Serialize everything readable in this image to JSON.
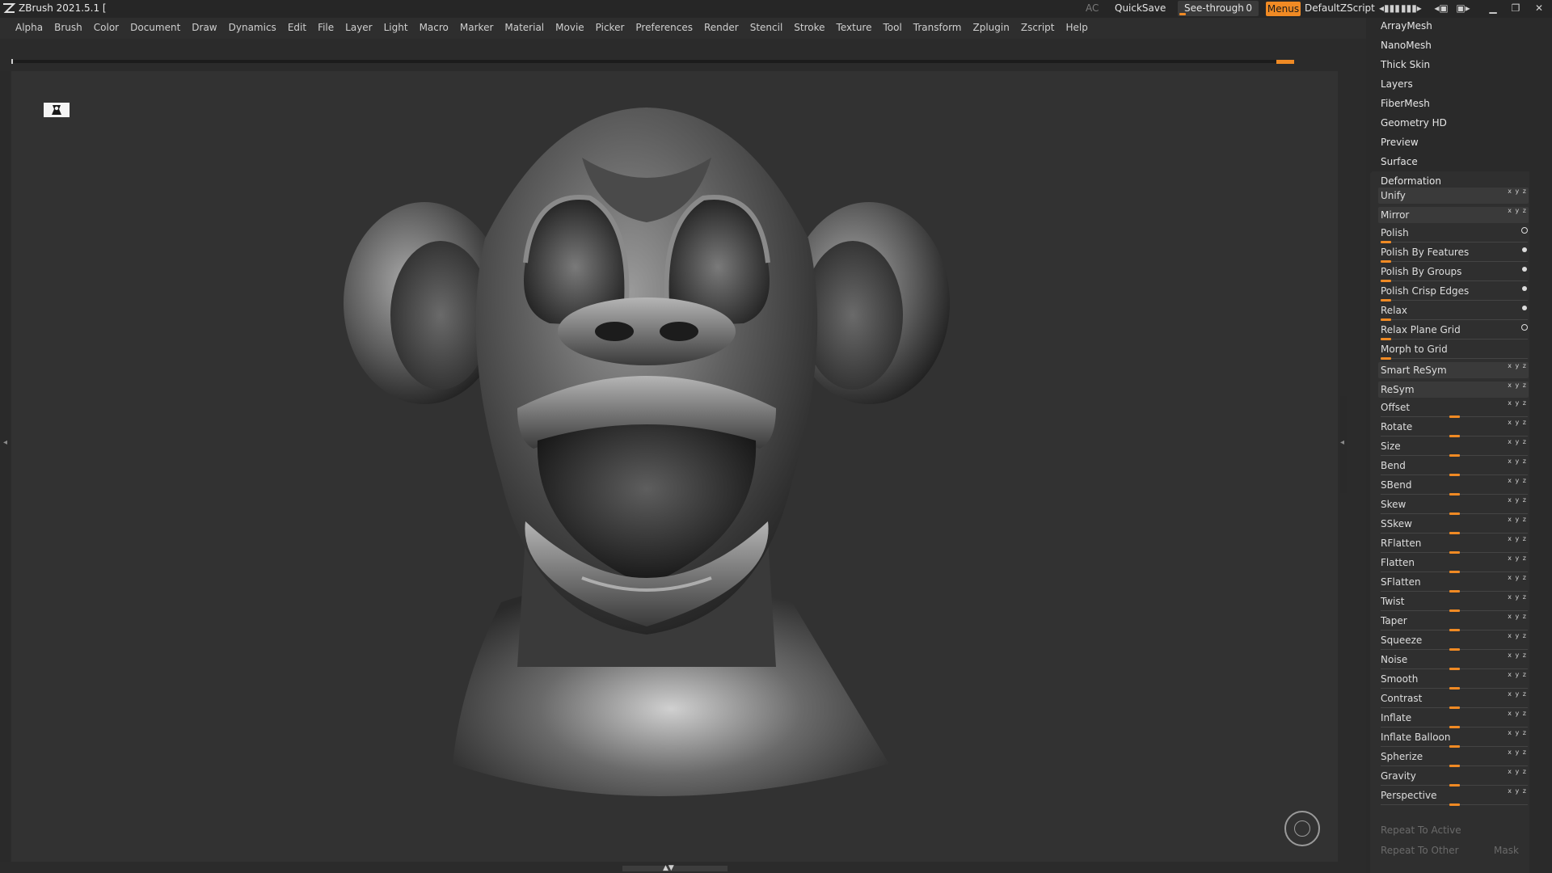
{
  "titlebar": {
    "app_title": "ZBrush 2021.5.1 [",
    "ac_label": "AC",
    "quicksave_label": "QuickSave",
    "seethrough_label": "See-through",
    "seethrough_value": "0",
    "menus_label": "Menus",
    "default_zscript_label": "DefaultZScript"
  },
  "menubar": {
    "items": [
      "Alpha",
      "Brush",
      "Color",
      "Document",
      "Draw",
      "Dynamics",
      "Edit",
      "File",
      "Layer",
      "Light",
      "Macro",
      "Marker",
      "Material",
      "Movie",
      "Picker",
      "Preferences",
      "Render",
      "Stencil",
      "Stroke",
      "Texture",
      "Tool",
      "Transform",
      "Zplugin",
      "Zscript",
      "Help"
    ]
  },
  "right_panel": {
    "sub_buttons": [
      "ArrayMesh",
      "NanoMesh",
      "Thick Skin",
      "Layers",
      "FiberMesh",
      "Geometry HD",
      "Preview",
      "Surface"
    ],
    "deformation": {
      "title": "Deformation",
      "rows": [
        {
          "label": "Unify",
          "kind": "button",
          "axes": "x y z"
        },
        {
          "label": "Mirror",
          "kind": "button",
          "axes": "x y z"
        },
        {
          "label": "Polish",
          "kind": "slider",
          "value": 0,
          "marker": "ring"
        },
        {
          "label": "Polish By Features",
          "kind": "slider",
          "value": 0,
          "marker": "dot"
        },
        {
          "label": "Polish By Groups",
          "kind": "slider",
          "value": 0,
          "marker": "dot"
        },
        {
          "label": "Polish Crisp Edges",
          "kind": "slider",
          "value": 0,
          "marker": "dot"
        },
        {
          "label": "Relax",
          "kind": "slider",
          "value": 0,
          "marker": "dot"
        },
        {
          "label": "Relax Plane Grid",
          "kind": "slider",
          "value": 0,
          "marker": "ring"
        },
        {
          "label": "Morph to Grid",
          "kind": "slider",
          "value": 0,
          "marker": ""
        },
        {
          "label": "Smart ReSym",
          "kind": "button",
          "axes": "x y z"
        },
        {
          "label": "ReSym",
          "kind": "button",
          "axes": "x y z"
        },
        {
          "label": "Offset",
          "kind": "slider",
          "value": 0.5,
          "axes": "x y z"
        },
        {
          "label": "Rotate",
          "kind": "slider",
          "value": 0.5,
          "axes": "x y z"
        },
        {
          "label": "Size",
          "kind": "slider",
          "value": 0.5,
          "axes": "x y z"
        },
        {
          "label": "Bend",
          "kind": "slider",
          "value": 0.5,
          "axes": "x y z"
        },
        {
          "label": "SBend",
          "kind": "slider",
          "value": 0.5,
          "axes": "x y z"
        },
        {
          "label": "Skew",
          "kind": "slider",
          "value": 0.5,
          "axes": "x y z"
        },
        {
          "label": "SSkew",
          "kind": "slider",
          "value": 0.5,
          "axes": "x y z"
        },
        {
          "label": "RFlatten",
          "kind": "slider",
          "value": 0.5,
          "axes": "x y z"
        },
        {
          "label": "Flatten",
          "kind": "slider",
          "value": 0.5,
          "axes": "x y z"
        },
        {
          "label": "SFlatten",
          "kind": "slider",
          "value": 0.5,
          "axes": "x y z"
        },
        {
          "label": "Twist",
          "kind": "slider",
          "value": 0.5,
          "axes": "x y z"
        },
        {
          "label": "Taper",
          "kind": "slider",
          "value": 0.5,
          "axes": "x y z"
        },
        {
          "label": "Squeeze",
          "kind": "slider",
          "value": 0.5,
          "axes": "x y z"
        },
        {
          "label": "Noise",
          "kind": "slider",
          "value": 0.5,
          "axes": "x y z"
        },
        {
          "label": "Smooth",
          "kind": "slider",
          "value": 0.5,
          "axes": "x y z"
        },
        {
          "label": "Contrast",
          "kind": "slider",
          "value": 0.5,
          "axes": "x y z"
        },
        {
          "label": "Inflate",
          "kind": "slider",
          "value": 0.5,
          "axes": "x y z"
        },
        {
          "label": "Inflate Balloon",
          "kind": "slider",
          "value": 0.5,
          "axes": "x y z"
        },
        {
          "label": "Spherize",
          "kind": "slider",
          "value": 0.5,
          "axes": "x y z"
        },
        {
          "label": "Gravity",
          "kind": "slider",
          "value": 0.5,
          "axes": "x y z"
        },
        {
          "label": "Perspective",
          "kind": "slider",
          "value": 0.5,
          "axes": "x y z"
        }
      ],
      "repeat_to_active": "Repeat To Active",
      "repeat_to_other": "Repeat To Other",
      "mask": "Mask"
    }
  },
  "colors": {
    "accent": "#f08a24"
  }
}
